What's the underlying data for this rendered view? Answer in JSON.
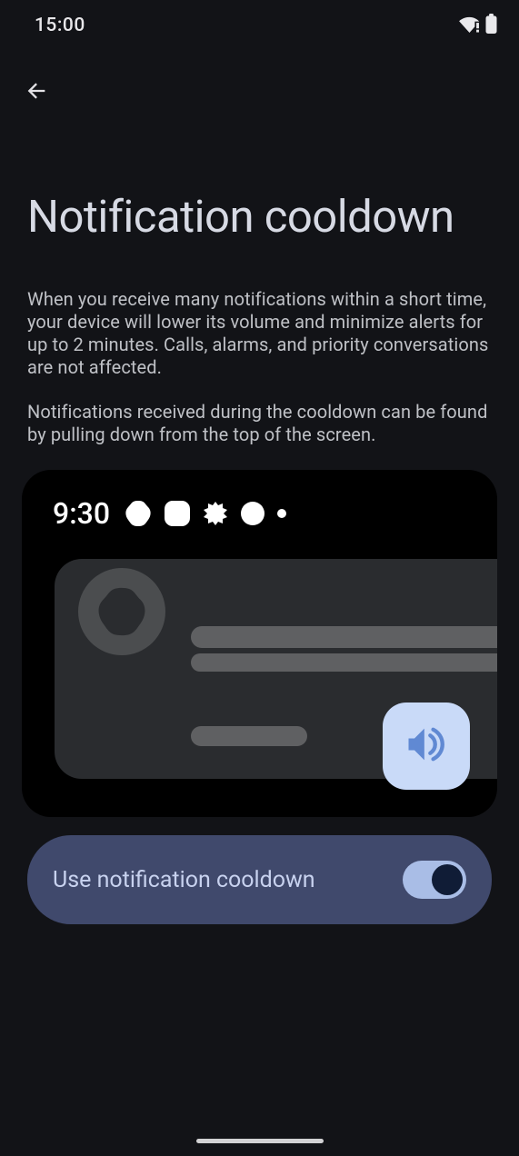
{
  "status_bar": {
    "time": "15:00"
  },
  "page": {
    "title": "Notification cooldown",
    "desc_p1": "When you receive many notifications within a short time, your device will lower its volume and minimize alerts for up to 2 minutes. Calls, alarms, and priority conversations are not affected.",
    "desc_p2": "Notifications received during the cooldown can be found by pulling down from the top of the screen."
  },
  "illustration": {
    "time": "9:30"
  },
  "toggle": {
    "label": "Use notification cooldown",
    "state": "on"
  }
}
